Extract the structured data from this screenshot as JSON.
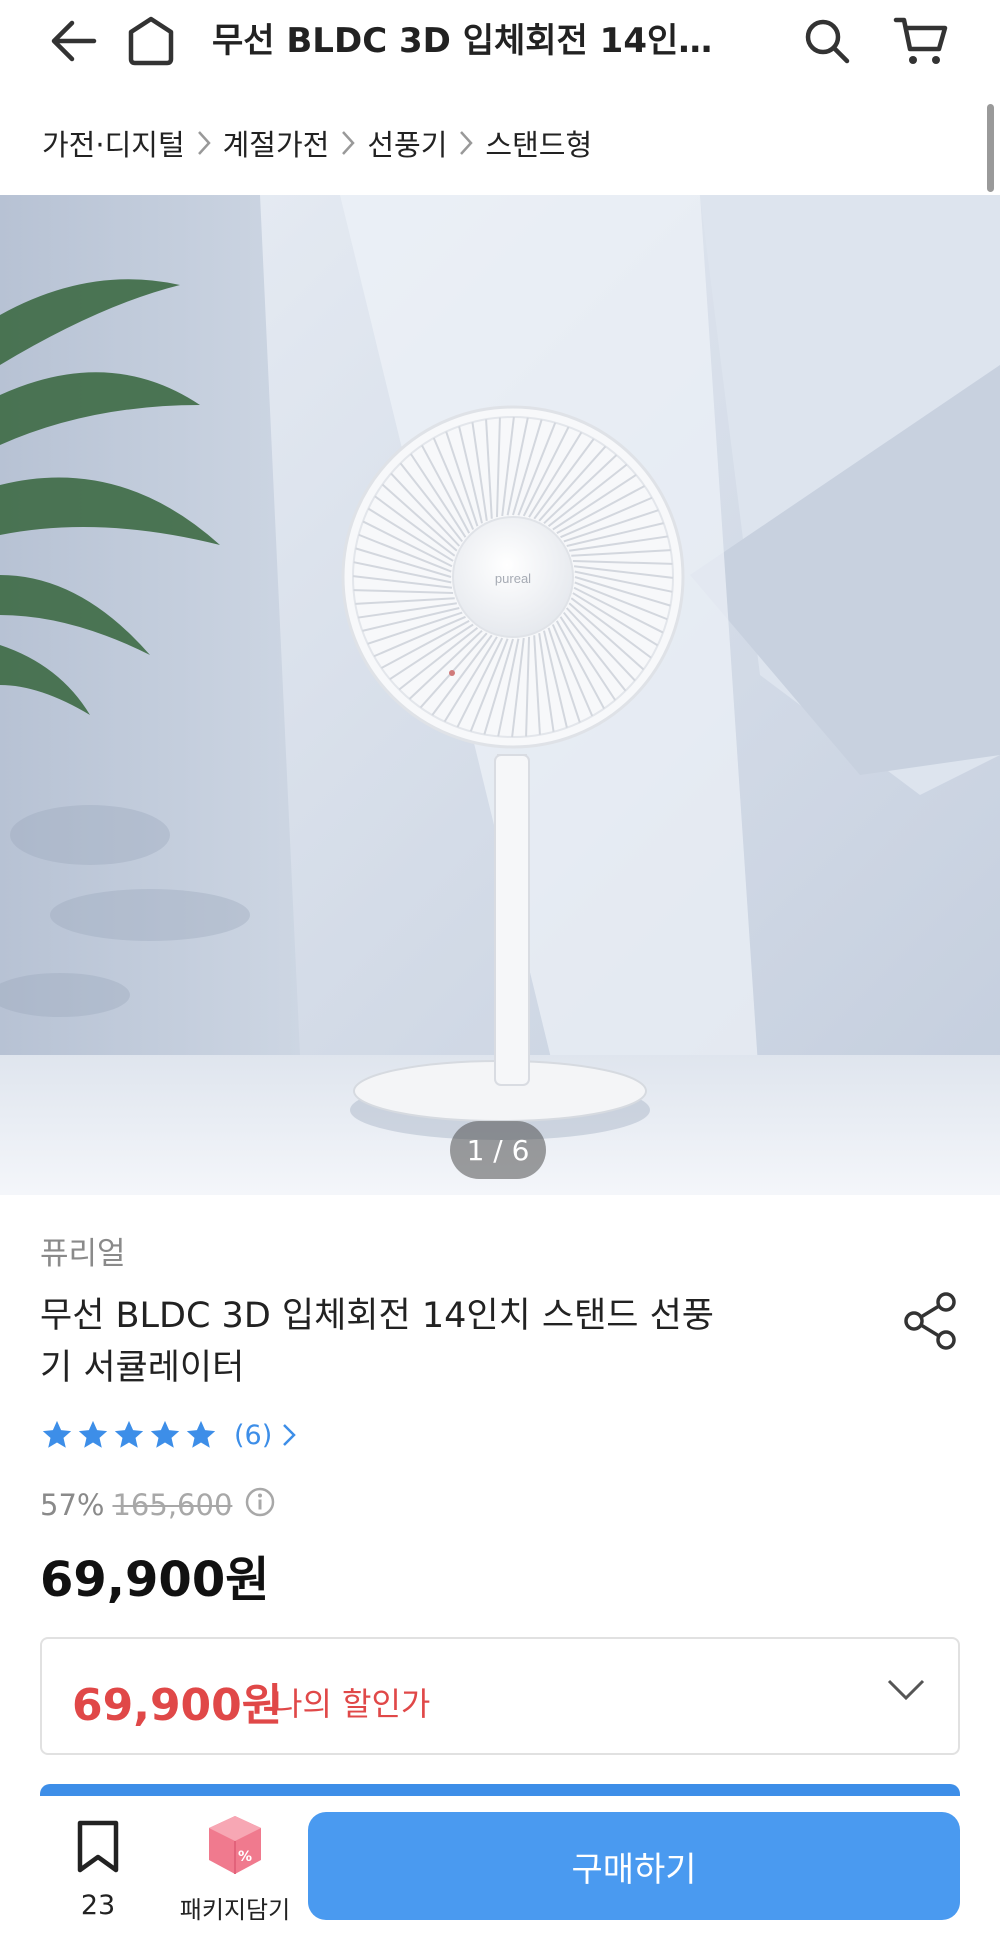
{
  "header": {
    "title": "무선 BLDC 3D 입체회전 14인치 스탠드 선풍기 서큘레이터"
  },
  "breadcrumb": [
    "가전·디지털",
    "계절가전",
    "선풍기",
    "스탠드형"
  ],
  "gallery": {
    "counter": "1 / 6",
    "current": 1,
    "total": 6,
    "fan_logo_text": "pureal"
  },
  "product": {
    "brand": "퓨리얼",
    "title": "무선 BLDC 3D 입체회전 14인치 스탠드 선풍기 서큘레이터",
    "rating_stars": 5,
    "review_count": "(6)",
    "discount_rate": "57%",
    "original_price": "165,600",
    "price": "69,900원"
  },
  "my_discount": {
    "price": "69,900원",
    "label": "나의 할인가"
  },
  "bottom_bar": {
    "bookmark_count": "23",
    "package_label": "패키지담기",
    "buy_label": "구매하기"
  },
  "colors": {
    "accent_blue": "#4a9af0",
    "star_blue": "#3d8ee8",
    "sale_red": "#e04848",
    "package_pink": "#f07a8e"
  }
}
